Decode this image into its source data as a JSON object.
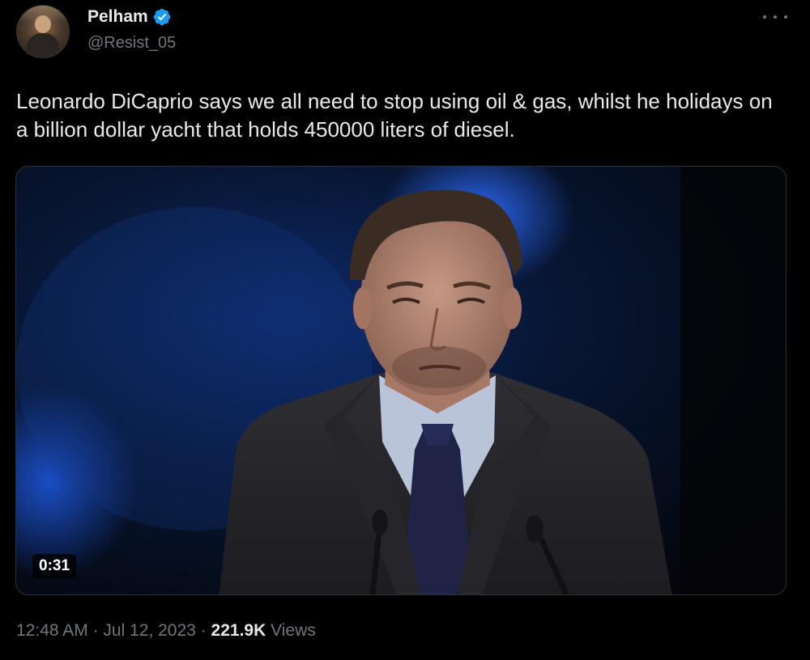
{
  "author": {
    "display_name": "Pelham",
    "handle": "@Resist_05",
    "verified": true,
    "verified_icon": "verified-badge-icon",
    "verified_color": "#1d9bf0"
  },
  "tweet": {
    "text": "Leonardo DiCaprio says we all need to stop using oil & gas, whilst he holidays on a billion dollar yacht that holds 450000 liters of diesel."
  },
  "media": {
    "type": "video",
    "duration": "0:31"
  },
  "meta": {
    "time": "12:48 AM",
    "separator": "·",
    "date": "Jul 12, 2023",
    "views_count": "221.9K",
    "views_label": "Views"
  },
  "menu": {
    "icon": "more-options-icon"
  },
  "colors": {
    "background": "#000000",
    "text_primary": "#e7e9ea",
    "text_secondary": "#71767b",
    "accent": "#1d9bf0"
  }
}
